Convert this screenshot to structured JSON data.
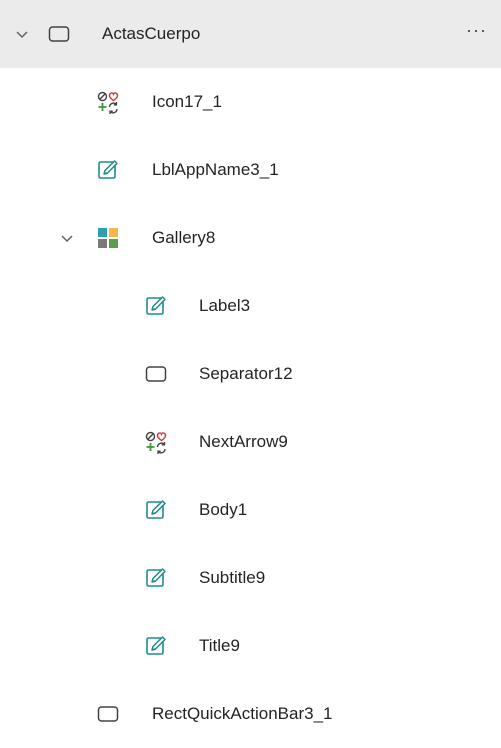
{
  "tree": {
    "root": {
      "label": "ActasCuerpo",
      "icon": "container-icon",
      "more_label": "···"
    },
    "items": [
      {
        "label": "Icon17_1",
        "icon": "icon-control-icon"
      },
      {
        "label": "LblAppName3_1",
        "icon": "label-edit-icon"
      },
      {
        "label": "Gallery8",
        "icon": "gallery-icon"
      },
      {
        "label": "Label3",
        "icon": "label-edit-icon"
      },
      {
        "label": "Separator12",
        "icon": "rectangle-icon"
      },
      {
        "label": "NextArrow9",
        "icon": "icon-control-icon"
      },
      {
        "label": "Body1",
        "icon": "label-edit-icon"
      },
      {
        "label": "Subtitle9",
        "icon": "label-edit-icon"
      },
      {
        "label": "Title9",
        "icon": "label-edit-icon"
      },
      {
        "label": "RectQuickActionBar3_1",
        "icon": "rectangle-icon"
      }
    ]
  },
  "colors": {
    "selected_row": "#ebebeb",
    "edit_icon": "#1e8c8a",
    "gallery_teal": "#2c9fb6",
    "gallery_orange": "#f2b84b",
    "gallery_green": "#5aa04a",
    "gallery_gray": "#7a7a7a",
    "icon_red": "#d13438",
    "icon_green": "#3a9a3a"
  }
}
